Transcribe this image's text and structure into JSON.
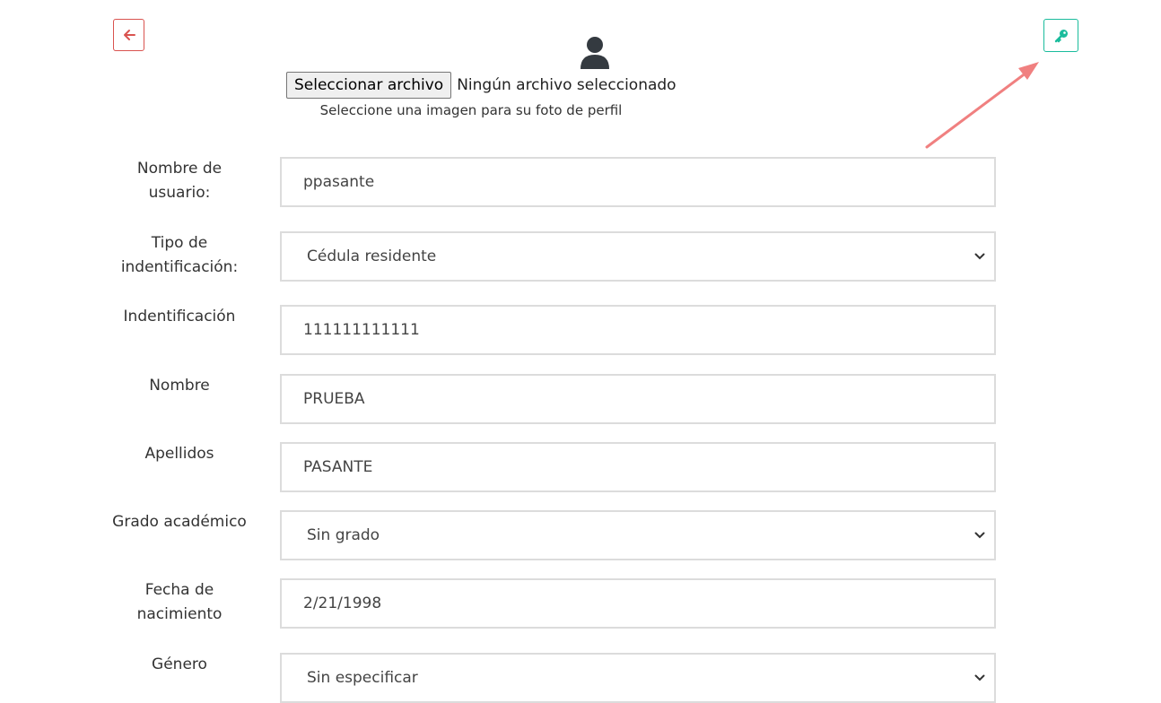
{
  "header": {
    "back_icon": "arrow-left-icon",
    "key_icon": "key-icon",
    "avatar_icon": "user-icon",
    "colors": {
      "back": "#d9534f",
      "key": "#1abc9c",
      "annotation_arrow": "#f08080"
    }
  },
  "photo": {
    "file_button_label": "Seleccionar archivo",
    "file_status": "Ningún archivo seleccionado",
    "hint": "Seleccione una imagen para su foto de perfil"
  },
  "form": {
    "username": {
      "label_line1": "Nombre de",
      "label_line2": "usuario:",
      "value": "ppasante"
    },
    "id_type": {
      "label_line1": "Tipo de",
      "label_line2": "indentificación:",
      "value": "Cédula residente"
    },
    "identification": {
      "label": "Indentificación",
      "value": "111111111111"
    },
    "first_name": {
      "label": "Nombre",
      "value": "PRUEBA"
    },
    "last_name": {
      "label": "Apellidos",
      "value": "PASANTE"
    },
    "degree": {
      "label": "Grado académico",
      "value": "Sin grado"
    },
    "birth_date": {
      "label_line1": "Fecha de",
      "label_line2": "nacimiento",
      "value": "2/21/1998"
    },
    "gender": {
      "label": "Género",
      "value": "Sin especificar"
    }
  }
}
